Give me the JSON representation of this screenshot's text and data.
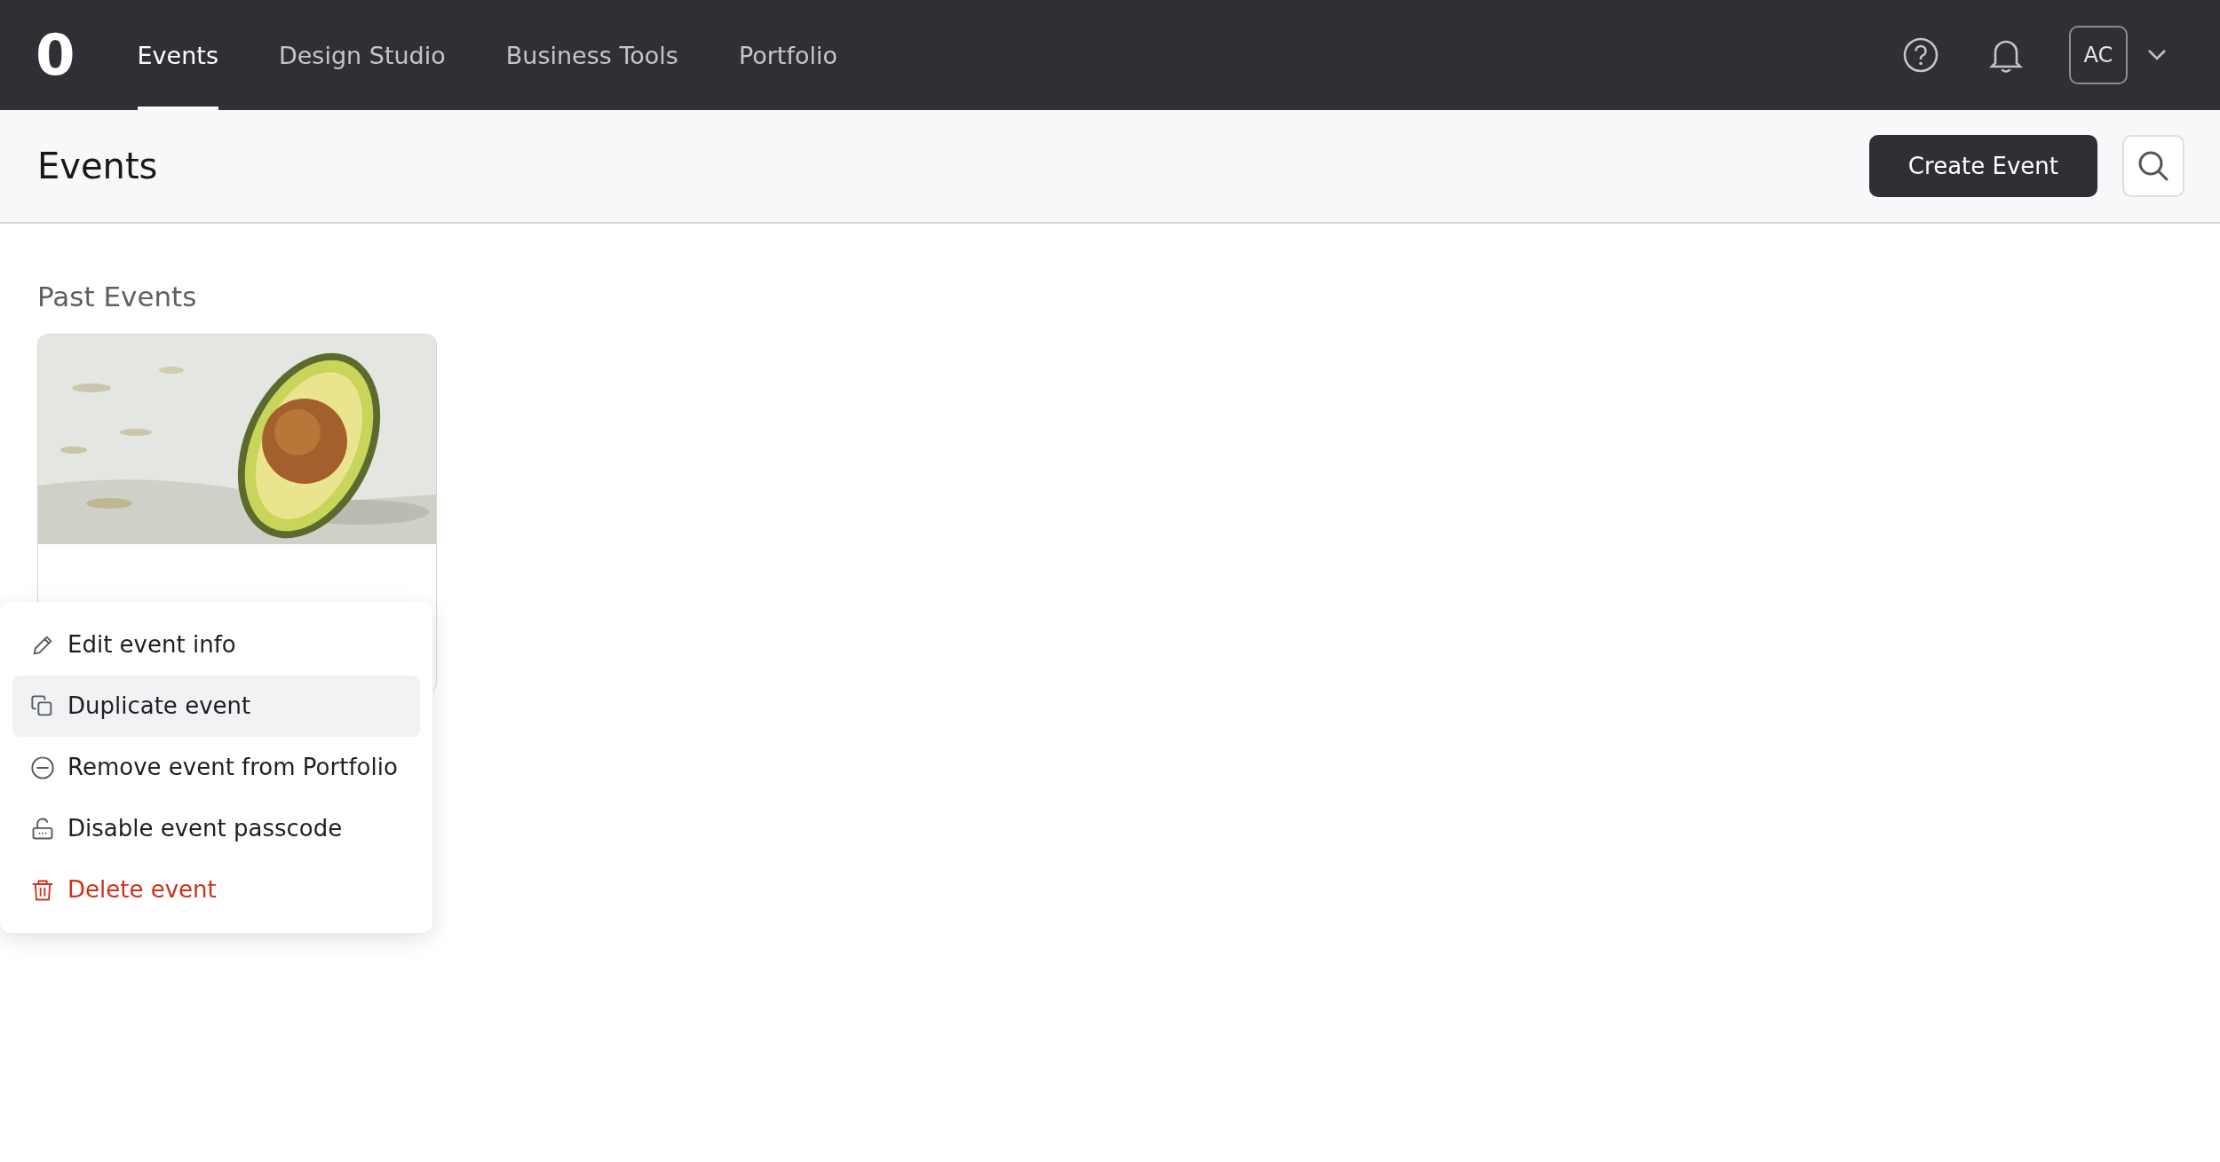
{
  "nav": {
    "logo": "0",
    "tabs": [
      {
        "label": "Events",
        "selected": true
      },
      {
        "label": "Design Studio",
        "selected": false
      },
      {
        "label": "Business Tools",
        "selected": false
      },
      {
        "label": "Portfolio",
        "selected": false
      }
    ],
    "avatar": "AC"
  },
  "header": {
    "title": "Events",
    "create_button": "Create Event"
  },
  "section": {
    "title": "Past Events"
  },
  "context_menu": {
    "items": [
      {
        "label": "Edit event info",
        "kind": "normal",
        "selected": false
      },
      {
        "label": "Duplicate event",
        "kind": "normal",
        "selected": true
      },
      {
        "label": "Remove event from Portfolio",
        "kind": "normal",
        "selected": false
      },
      {
        "label": "Disable event passcode",
        "kind": "normal",
        "selected": false
      },
      {
        "label": "Delete event",
        "kind": "danger",
        "selected": false
      }
    ]
  }
}
